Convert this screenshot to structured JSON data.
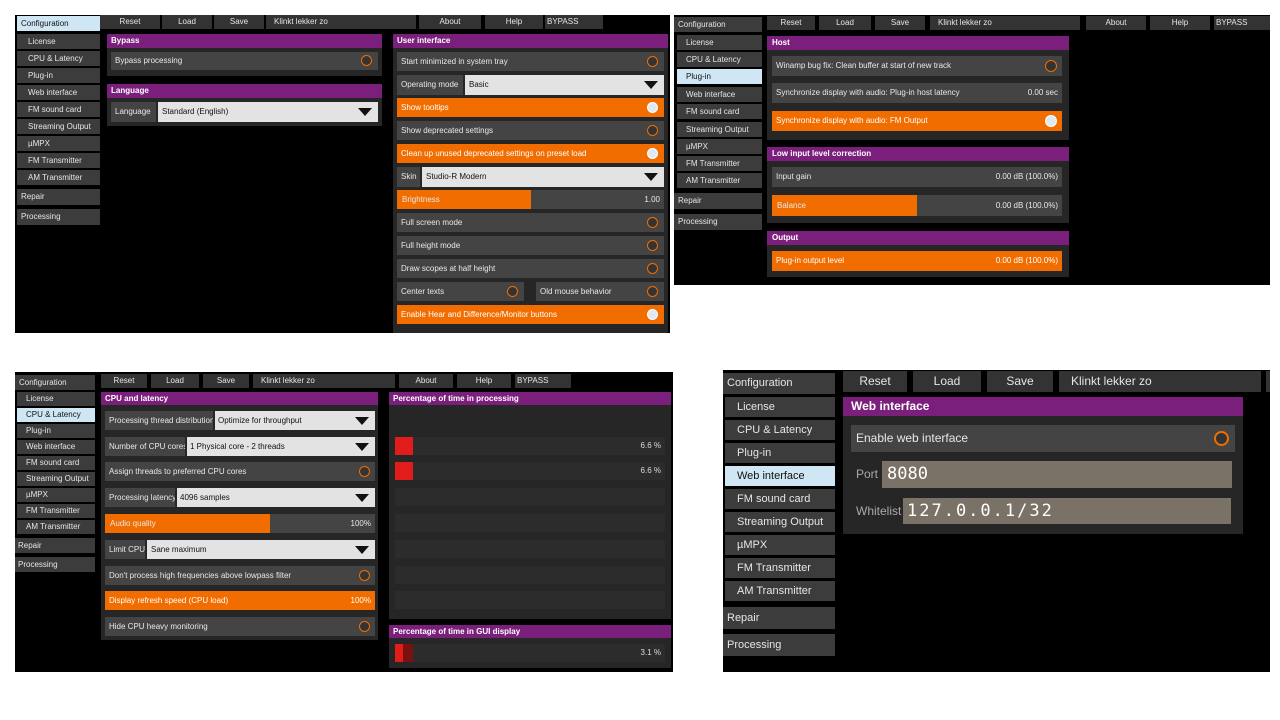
{
  "colors": {
    "accent": "#f26d00",
    "section": "#7b1f7c",
    "active": "#cfe6f5",
    "bar": "#e21b1b"
  },
  "panel1": {
    "sidebar": [
      {
        "label": "Configuration",
        "active": true
      },
      {
        "label": "License"
      },
      {
        "label": "CPU & Latency"
      },
      {
        "label": "Plug-in"
      },
      {
        "label": "Web interface"
      },
      {
        "label": "FM sound card"
      },
      {
        "label": "Streaming Output"
      },
      {
        "label": "µMPX"
      },
      {
        "label": "FM Transmitter"
      },
      {
        "label": "AM Transmitter"
      },
      {
        "label": "Repair"
      },
      {
        "label": "Processing"
      }
    ],
    "toolbar": {
      "reset": "Reset",
      "load": "Load",
      "save": "Save",
      "preset": "Klinkt lekker zo",
      "about": "About",
      "help": "Help",
      "bypass": "BYPASS"
    },
    "bypass": {
      "title": "Bypass",
      "processing": "Bypass processing"
    },
    "language": {
      "title": "Language",
      "label": "Language",
      "value": "Standard (English)"
    },
    "ui": {
      "title": "User interface",
      "tray": "Start minimized in system tray",
      "mode_label": "Operating mode",
      "mode_value": "Basic",
      "tooltips": "Show tooltips",
      "deprecated": "Show deprecated settings",
      "cleanup": "Clean up unused deprecated settings on preset load",
      "skin_label": "Skin",
      "skin_value": "Studio-R Modern",
      "brightness": "Brightness",
      "brightness_value": "1.00",
      "brightness_level": 0.5,
      "fullscreen": "Full screen mode",
      "fullheight": "Full height mode",
      "scopes": "Draw scopes at half height",
      "center": "Center texts",
      "oldmouse": "Old mouse behavior",
      "hear": "Enable Hear and Difference/Monitor buttons"
    }
  },
  "panel2": {
    "sidebar": [
      {
        "label": "Configuration"
      },
      {
        "label": "License"
      },
      {
        "label": "CPU & Latency"
      },
      {
        "label": "Plug-in",
        "active": true
      },
      {
        "label": "Web interface"
      },
      {
        "label": "FM sound card"
      },
      {
        "label": "Streaming Output"
      },
      {
        "label": "µMPX"
      },
      {
        "label": "FM Transmitter"
      },
      {
        "label": "AM Transmitter"
      },
      {
        "label": "Repair"
      },
      {
        "label": "Processing"
      }
    ],
    "toolbar": {
      "reset": "Reset",
      "load": "Load",
      "save": "Save",
      "preset": "Klinkt lekker zo",
      "about": "About",
      "help": "Help",
      "bypass": "BYPASS"
    },
    "host": {
      "title": "Host",
      "winamp": "Winamp bug fix: Clean buffer at start of new track",
      "sync_host": "Synchronize display with audio: Plug-in host latency",
      "sync_host_value": "0.00 sec",
      "sync_fm": "Synchronize display with audio: FM Output"
    },
    "low": {
      "title": "Low input level correction",
      "gain": "Input gain",
      "gain_value": "0.00 dB (100.0%)",
      "balance": "Balance",
      "balance_value": "0.00 dB (100.0%)",
      "balance_level": 0.5
    },
    "output": {
      "title": "Output",
      "level": "Plug-in output level",
      "level_value": "0.00 dB (100.0%)"
    }
  },
  "panel3": {
    "sidebar": [
      {
        "label": "Configuration"
      },
      {
        "label": "License"
      },
      {
        "label": "CPU & Latency",
        "active": true
      },
      {
        "label": "Plug-in"
      },
      {
        "label": "Web interface"
      },
      {
        "label": "FM sound card"
      },
      {
        "label": "Streaming Output"
      },
      {
        "label": "µMPX"
      },
      {
        "label": "FM Transmitter"
      },
      {
        "label": "AM Transmitter"
      },
      {
        "label": "Repair"
      },
      {
        "label": "Processing"
      }
    ],
    "toolbar": {
      "reset": "Reset",
      "load": "Load",
      "save": "Save",
      "preset": "Klinkt lekker zo",
      "about": "About",
      "help": "Help",
      "bypass": "BYPASS"
    },
    "cpu": {
      "title": "CPU and latency",
      "dist_label": "Processing thread distribution",
      "dist_value": "Optimize for throughput",
      "cores_label": "Number of CPU cores",
      "cores_value": "1 Physical core - 2 threads",
      "assign": "Assign threads to preferred CPU cores",
      "lat_label": "Processing latency",
      "lat_value": "4096 samples",
      "quality": "Audio quality",
      "quality_value": "100%",
      "quality_level": 0.6,
      "limit_label": "Limit CPU",
      "limit_value": "Sane maximum",
      "highfreq": "Don't process high frequencies above lowpass filter",
      "refresh": "Display refresh speed (CPU load)",
      "refresh_value": "100%",
      "hide": "Hide CPU heavy monitoring"
    },
    "proc": {
      "title": "Percentage of time in processing",
      "bars": [
        {
          "value": "6.6 %",
          "level": 0.066
        },
        {
          "value": "6.6 %",
          "level": 0.066
        }
      ]
    },
    "gui": {
      "title": "Percentage of time in GUI display",
      "value": "3.1 %",
      "level": 0.031
    }
  },
  "panel4": {
    "sidebar": [
      {
        "label": "Configuration"
      },
      {
        "label": "License"
      },
      {
        "label": "CPU & Latency"
      },
      {
        "label": "Plug-in"
      },
      {
        "label": "Web interface",
        "active": true
      },
      {
        "label": "FM sound card"
      },
      {
        "label": "Streaming Output"
      },
      {
        "label": "µMPX"
      },
      {
        "label": "FM Transmitter"
      },
      {
        "label": "AM Transmitter"
      },
      {
        "label": "Repair"
      },
      {
        "label": "Processing"
      }
    ],
    "toolbar": {
      "reset": "Reset",
      "load": "Load",
      "save": "Save",
      "preset": "Klinkt lekker zo"
    },
    "web": {
      "title": "Web interface",
      "enable": "Enable web interface",
      "port_label": "Port",
      "port_value": "8080",
      "white_label": "Whitelist",
      "white_value": "127.0.0.1/32"
    }
  }
}
